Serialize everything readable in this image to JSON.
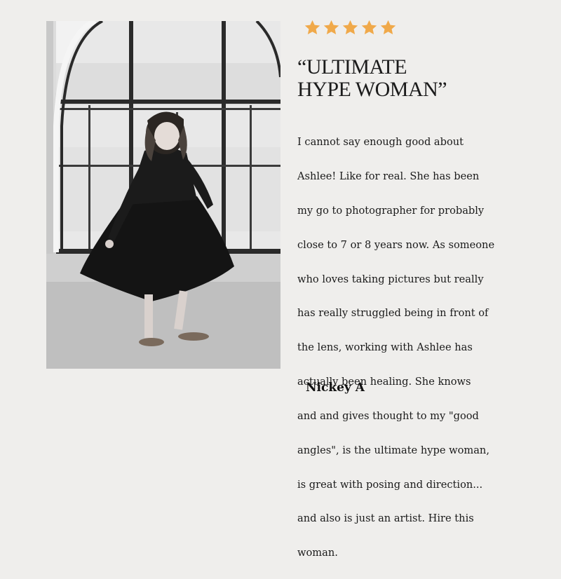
{
  "review": {
    "rating": 5,
    "rating_max": 5,
    "star_color": "#f0a94a",
    "headline_line1": "“ULTIMATE",
    "headline_line2": "HYPE WOMAN”",
    "body_lines": [
      "I cannot say enough good about",
      "Ashlee! Like for real. She has been",
      "my go to photographer for probably",
      "close to 7 or 8 years now. As someone",
      "who loves taking pictures but really",
      "has really struggled being in front of",
      "the lens, working with Ashlee has",
      "actually been healing. She knows",
      "and and gives thought to my \"good",
      "angles\", is the ultimate hype woman,",
      "is great with posing and direction...",
      "and also is just an artist.  Hire this",
      "woman."
    ],
    "reviewer_name": "Nickey A"
  },
  "photo": {
    "icon": "black-and-white-portrait-photo"
  }
}
